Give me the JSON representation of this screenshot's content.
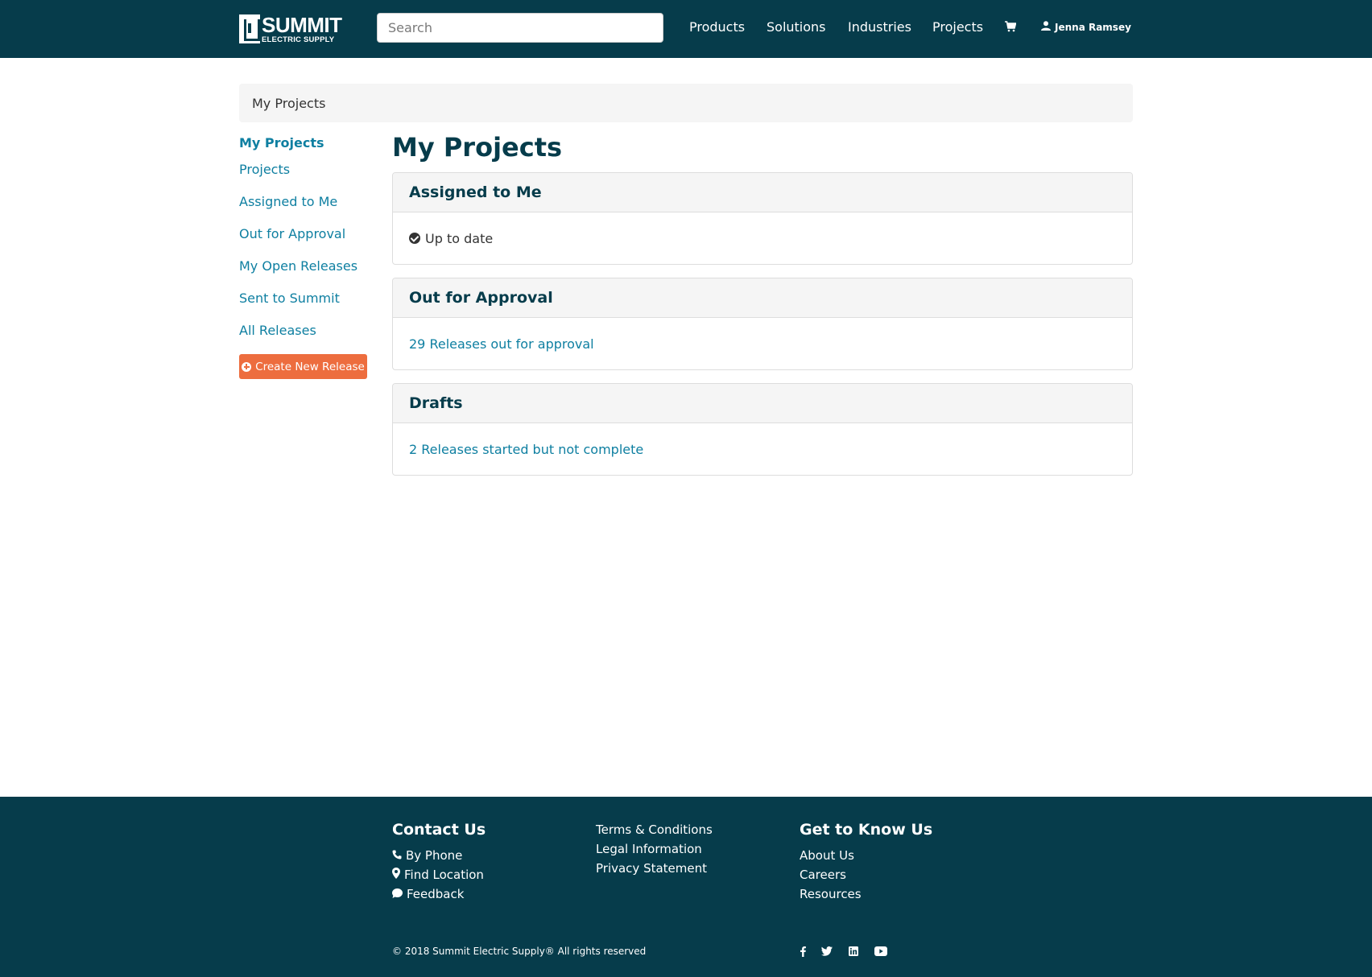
{
  "header": {
    "logo_main": "SUMMIT",
    "logo_sub": "ELECTRIC SUPPLY",
    "search_placeholder": "Search",
    "nav": [
      "Products",
      "Solutions",
      "Industries",
      "Projects"
    ],
    "cart_icon": "cart-icon",
    "user_name": "Jenna Ramsey",
    "user_icon": "user-icon"
  },
  "breadcrumb": "My Projects",
  "sidebar": {
    "title": "My Projects",
    "items": [
      "Projects",
      "Assigned to Me",
      "Out for Approval",
      "My Open Releases",
      "Sent to Summit",
      "All Releases"
    ],
    "create_button": "Create New Release",
    "create_icon": "plus-circle-icon"
  },
  "main": {
    "title": "My Projects",
    "panels": [
      {
        "heading": "Assigned to Me",
        "body": "Up to date",
        "icon": "check-circle-icon"
      },
      {
        "heading": "Out for Approval",
        "body": "29 Releases out for approval"
      },
      {
        "heading": "Drafts",
        "body": "2 Releases started but not complete"
      }
    ]
  },
  "footer": {
    "contact": {
      "heading": "Contact Us",
      "items": [
        {
          "label": "By Phone",
          "icon": "phone-icon"
        },
        {
          "label": "Find Location",
          "icon": "map-marker-icon"
        },
        {
          "label": "Feedback",
          "icon": "comment-icon"
        }
      ]
    },
    "legal": [
      "Terms & Conditions",
      "Legal Information",
      "Privacy Statement"
    ],
    "know_us": {
      "heading": "Get to Know Us",
      "items": [
        "About Us",
        "Careers",
        "Resources"
      ]
    },
    "copyright": "© 2018 Summit Electric Supply® All rights reserved",
    "social": [
      "facebook-icon",
      "twitter-icon",
      "linkedin-icon",
      "youtube-icon"
    ]
  },
  "colors": {
    "brand_dark": "#063c4b",
    "link": "#0e7fa1",
    "accent": "#ed6d3e"
  }
}
